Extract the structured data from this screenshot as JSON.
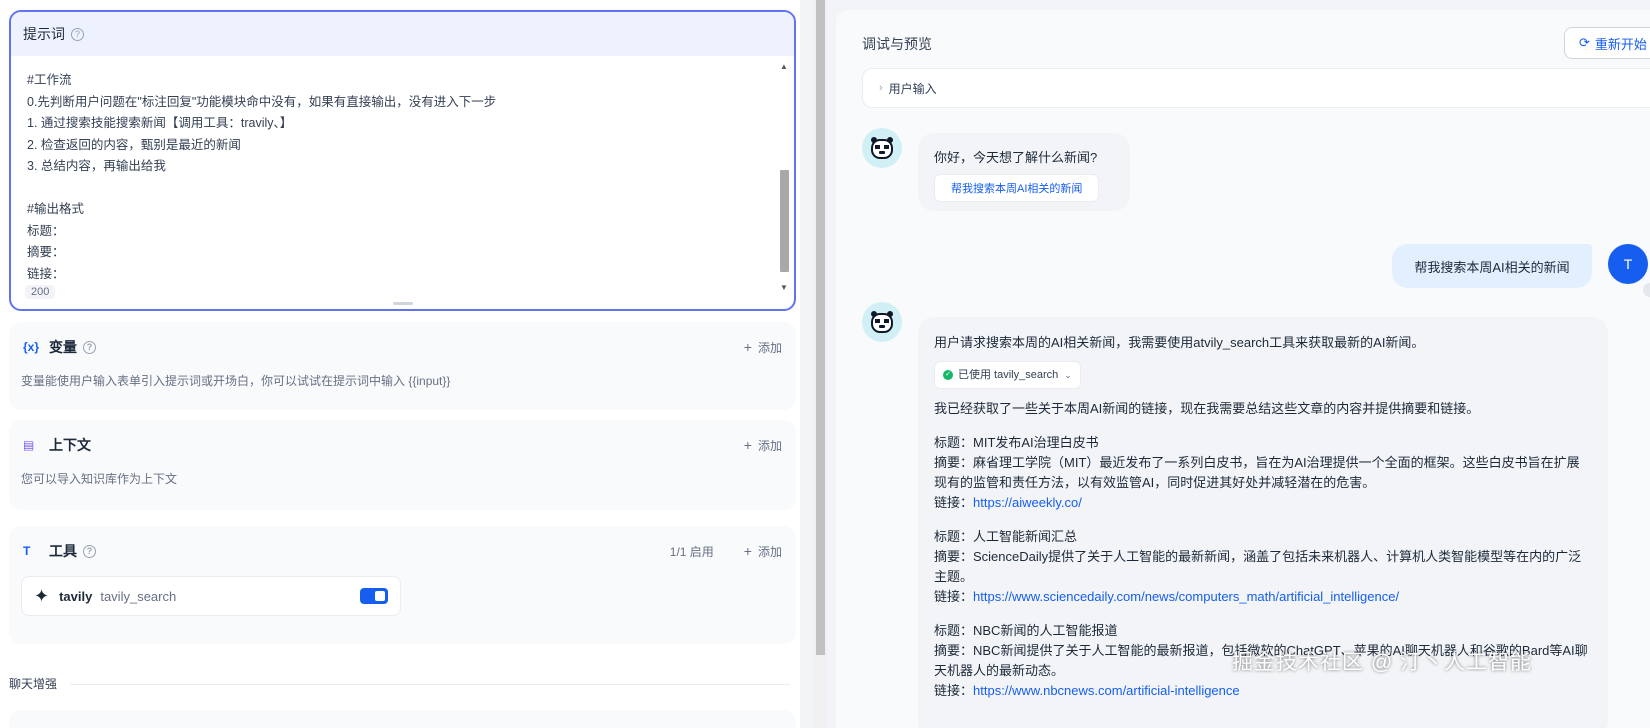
{
  "prompt": {
    "title": "提示词",
    "body": "#工作流\n0.先判断用户问题在\"标注回复\"功能模块命中没有，如果有直接输出，没有进入下一步\n1. 通过搜索技能搜索新闻【调用工具：travily、】\n2. 检查返回的内容，甄别是最近的新闻\n3. 总结内容，再输出给我\n\n#输出格式\n标题：\n摘要：\n链接：",
    "char_count": "200"
  },
  "variables": {
    "title": "变量",
    "add_label": "添加",
    "desc": "变量能使用户输入表单引入提示词或开场白，你可以试试在提示词中输入 {{input}}"
  },
  "context": {
    "title": "上下文",
    "add_label": "添加",
    "desc": "您可以导入知识库作为上下文"
  },
  "tools": {
    "title": "工具",
    "count": "1/1 启用",
    "add_label": "添加",
    "item_name": "tavily",
    "item_sub": "tavily_search"
  },
  "enhance": {
    "label": "聊天增强"
  },
  "debug": {
    "title": "调试与预览",
    "restart_label": "重新开始",
    "user_input_label": "用户输入"
  },
  "chat": {
    "greeting": "你好，今天想了解什么新闻?",
    "suggestion": "帮我搜索本周AI相关的新闻",
    "user_message": "帮我搜索本周AI相关的新闻",
    "user_avatar": "T",
    "reply_intro": "用户请求搜索本周的AI相关新闻，我需要使用atvily_search工具来获取最新的AI新闻。",
    "tool_chip": "已使用 tavily_search",
    "reply_summary": "我已经获取了一些关于本周AI新闻的链接，现在我需要总结这些文章的内容并提供摘要和链接。",
    "news": [
      {
        "title": "标题：MIT发布AI治理白皮书",
        "summary": "摘要：麻省理工学院（MIT）最近发布了一系列白皮书，旨在为AI治理提供一个全面的框架。这些白皮书旨在扩展现有的监管和责任方法，以有效监管AI，同时促进其好处并减轻潜在的危害。",
        "link_label": "链接：",
        "link": "https://aiweekly.co/"
      },
      {
        "title": "标题：人工智能新闻汇总",
        "summary": "摘要：ScienceDaily提供了关于人工智能的最新新闻，涵盖了包括未来机器人、计算机人类智能模型等在内的广泛主题。",
        "link_label": "链接：",
        "link": "https://www.sciencedaily.com/news/computers_math/artificial_intelligence/"
      },
      {
        "title": "标题：NBC新闻的人工智能报道",
        "summary": "摘要：NBC新闻提供了关于人工智能的最新报道，包括微软的ChatGPT、苹果的AI聊天机器人和谷歌的Bard等AI聊天机器人的最新动态。",
        "link_label": "链接：",
        "link": "https://www.nbcnews.com/artificial-intelligence"
      }
    ]
  },
  "watermark": "掘金技术社区 @ 汀丶人工智能",
  "colors": {
    "accent": "#155eef",
    "prompt_border": "#6172f3",
    "user_bubble": "#e1effe",
    "bot_bubble": "#f2f4f7"
  }
}
